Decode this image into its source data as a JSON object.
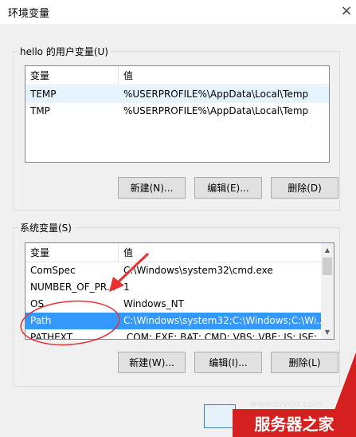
{
  "window": {
    "title": "环境变量",
    "close_glyph": "×"
  },
  "user_vars": {
    "group_label": "hello 的用户变量(U)",
    "columns": [
      "变量",
      "值"
    ],
    "rows": [
      {
        "name": "TEMP",
        "value": "%USERPROFILE%\\AppData\\Local\\Temp"
      },
      {
        "name": "TMP",
        "value": "%USERPROFILE%\\AppData\\Local\\Temp"
      }
    ],
    "buttons": {
      "new": "新建(N)...",
      "edit": "编辑(E)...",
      "delete": "删除(D)"
    }
  },
  "system_vars": {
    "group_label": "系统变量(S)",
    "columns": [
      "变量",
      "值"
    ],
    "rows": [
      {
        "name": "ComSpec",
        "value": "C:\\Windows\\system32\\cmd.exe"
      },
      {
        "name": "NUMBER_OF_PR...",
        "value": "1"
      },
      {
        "name": "OS",
        "value": "Windows_NT"
      },
      {
        "name": "Path",
        "value": "C:\\Windows\\system32;C:\\Windows;C:\\Wi..."
      },
      {
        "name": "PATHEXT",
        "value": ".COM;.EXE;.BAT;.CMD;.VBS;.VBE;.JS;.JSE;..."
      }
    ],
    "selected_row": "Path",
    "buttons": {
      "new": "新建(W)...",
      "edit": "编辑(I)...",
      "delete": "删除(L)"
    }
  },
  "watermark": {
    "url": "www.zzvips.com",
    "brand": "服务器之家"
  },
  "colors": {
    "selection": "#3399ff",
    "annotation": "#e8312f",
    "brand_red": "#d61f1f"
  }
}
